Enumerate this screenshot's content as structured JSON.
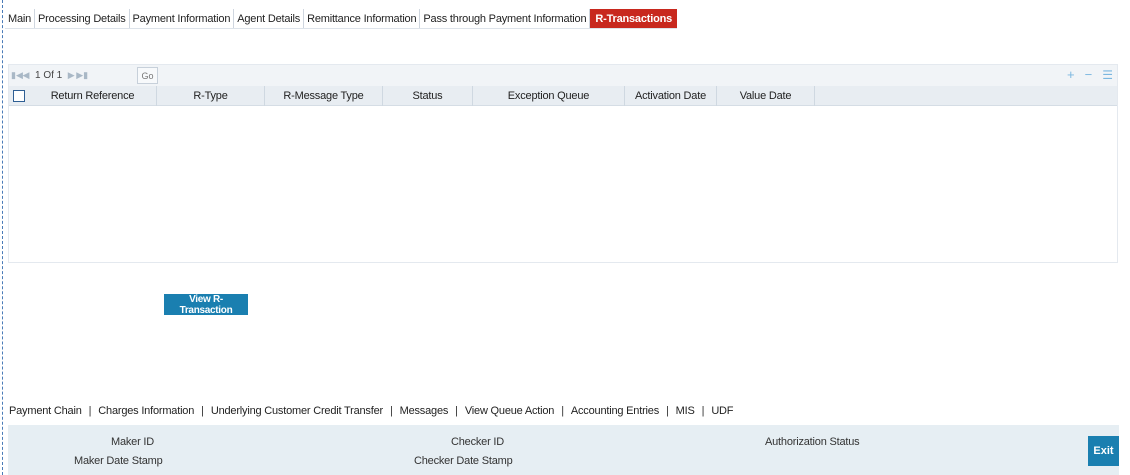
{
  "tabs": [
    {
      "label": "Main"
    },
    {
      "label": "Processing Details"
    },
    {
      "label": "Payment Information"
    },
    {
      "label": "Agent Details"
    },
    {
      "label": "Remittance Information"
    },
    {
      "label": "Pass through Payment Information"
    },
    {
      "label": "R-Transactions",
      "active": true
    }
  ],
  "grid": {
    "pager_text": "1 Of 1",
    "go_label": "Go",
    "columns": [
      "Return Reference",
      "R-Type",
      "R-Message Type",
      "Status",
      "Exception Queue",
      "Activation Date",
      "Value Date"
    ],
    "rows": []
  },
  "actions": {
    "view_r_transaction": "View R-Transaction"
  },
  "footer_links": [
    "Payment Chain",
    "Charges Information",
    "Underlying Customer Credit Transfer",
    "Messages",
    "View Queue Action",
    "Accounting Entries",
    "MIS",
    "UDF"
  ],
  "footer_separator": "|",
  "audit": {
    "maker_id": "Maker ID",
    "maker_date_stamp": "Maker Date Stamp",
    "checker_id": "Checker ID",
    "checker_date_stamp": "Checker Date Stamp",
    "authorization_status": "Authorization Status"
  },
  "exit_label": "Exit",
  "colors": {
    "active_tab": "#c8281e",
    "primary_button": "#1a7fb0",
    "audit_background": "#e6eef3"
  }
}
